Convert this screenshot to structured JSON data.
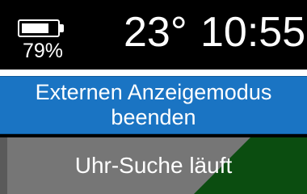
{
  "status": {
    "battery_percent": 79,
    "battery_label": "79%",
    "temperature": "23°",
    "time": "10:55"
  },
  "exit_button": {
    "label_line1": "Externen Anzeigemodus",
    "label_line2": "beenden",
    "color": "#1a74c3"
  },
  "search": {
    "label": "Uhr-Suche läuft",
    "background": "#767676",
    "progress_color": "#0b4d10"
  }
}
